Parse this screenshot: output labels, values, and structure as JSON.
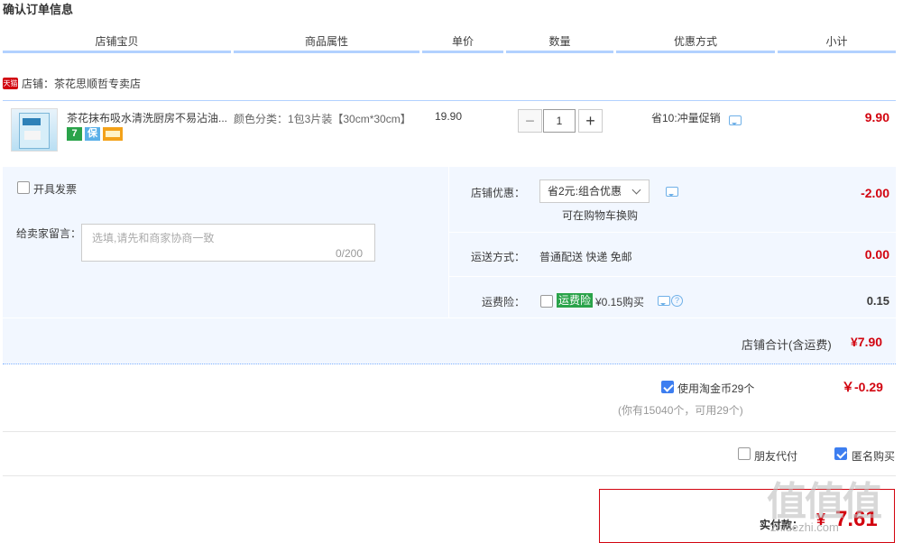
{
  "page": {
    "title": "确认订单信息"
  },
  "columns": [
    "店铺宝贝",
    "商品属性",
    "单价",
    "数量",
    "优惠方式",
    "小计"
  ],
  "store": {
    "badge": "天猫",
    "label": "店铺：茶花思顺哲专卖店"
  },
  "item": {
    "title": "茶花抹布吸水清洗厨房不易沾油...",
    "service_icons": [
      {
        "name": "seven-day-return-icon",
        "text": "7",
        "color": "#2aa34a"
      },
      {
        "name": "guarantee-icon",
        "text": "保",
        "color": "#5bb0e8"
      },
      {
        "name": "credit-card-icon",
        "text": "",
        "color": "#f3a21a"
      }
    ],
    "attributes": "颜色分类：1包3片装【30cm*30cm】",
    "unit_price": "19.90",
    "quantity": "1",
    "promotion": "省10:冲量促销",
    "subtotal": "9.90"
  },
  "options": {
    "invoice_label": "开具发票",
    "memo_label": "给卖家留言：",
    "memo_placeholder": "选填,请先和商家协商一致",
    "memo_count": "0/200"
  },
  "discount": {
    "label": "店铺优惠：",
    "selected": "省2元:组合优惠",
    "note": "可在购物车换购",
    "value": "-2.00"
  },
  "shipping": {
    "label": "运送方式：",
    "text": "普通配送 快递 免邮",
    "value": "0.00"
  },
  "insurance": {
    "label": "运费险：",
    "tag": "运费险",
    "text": "¥0.15购买",
    "value": "0.15"
  },
  "store_total": {
    "label": "店铺合计(含运费)",
    "value": "¥7.90"
  },
  "coins": {
    "label": "使用淘金币29个",
    "sub": "(你有15040个，可用29个)",
    "value": "￥-0.29"
  },
  "friend_pay_label": "朋友代付",
  "anonymous_label": "匿名购买",
  "total": {
    "label": "实付款：",
    "yen": "¥",
    "value": "7.61"
  },
  "watermark": {
    "main": "值值值",
    "sub": "zhidezhi.com"
  },
  "colors": {
    "accent_red": "#d2040f",
    "header_line": "#b2d1ff",
    "panel_bg": "#f2f7ff",
    "checkbox_blue": "#3d7ef0"
  }
}
